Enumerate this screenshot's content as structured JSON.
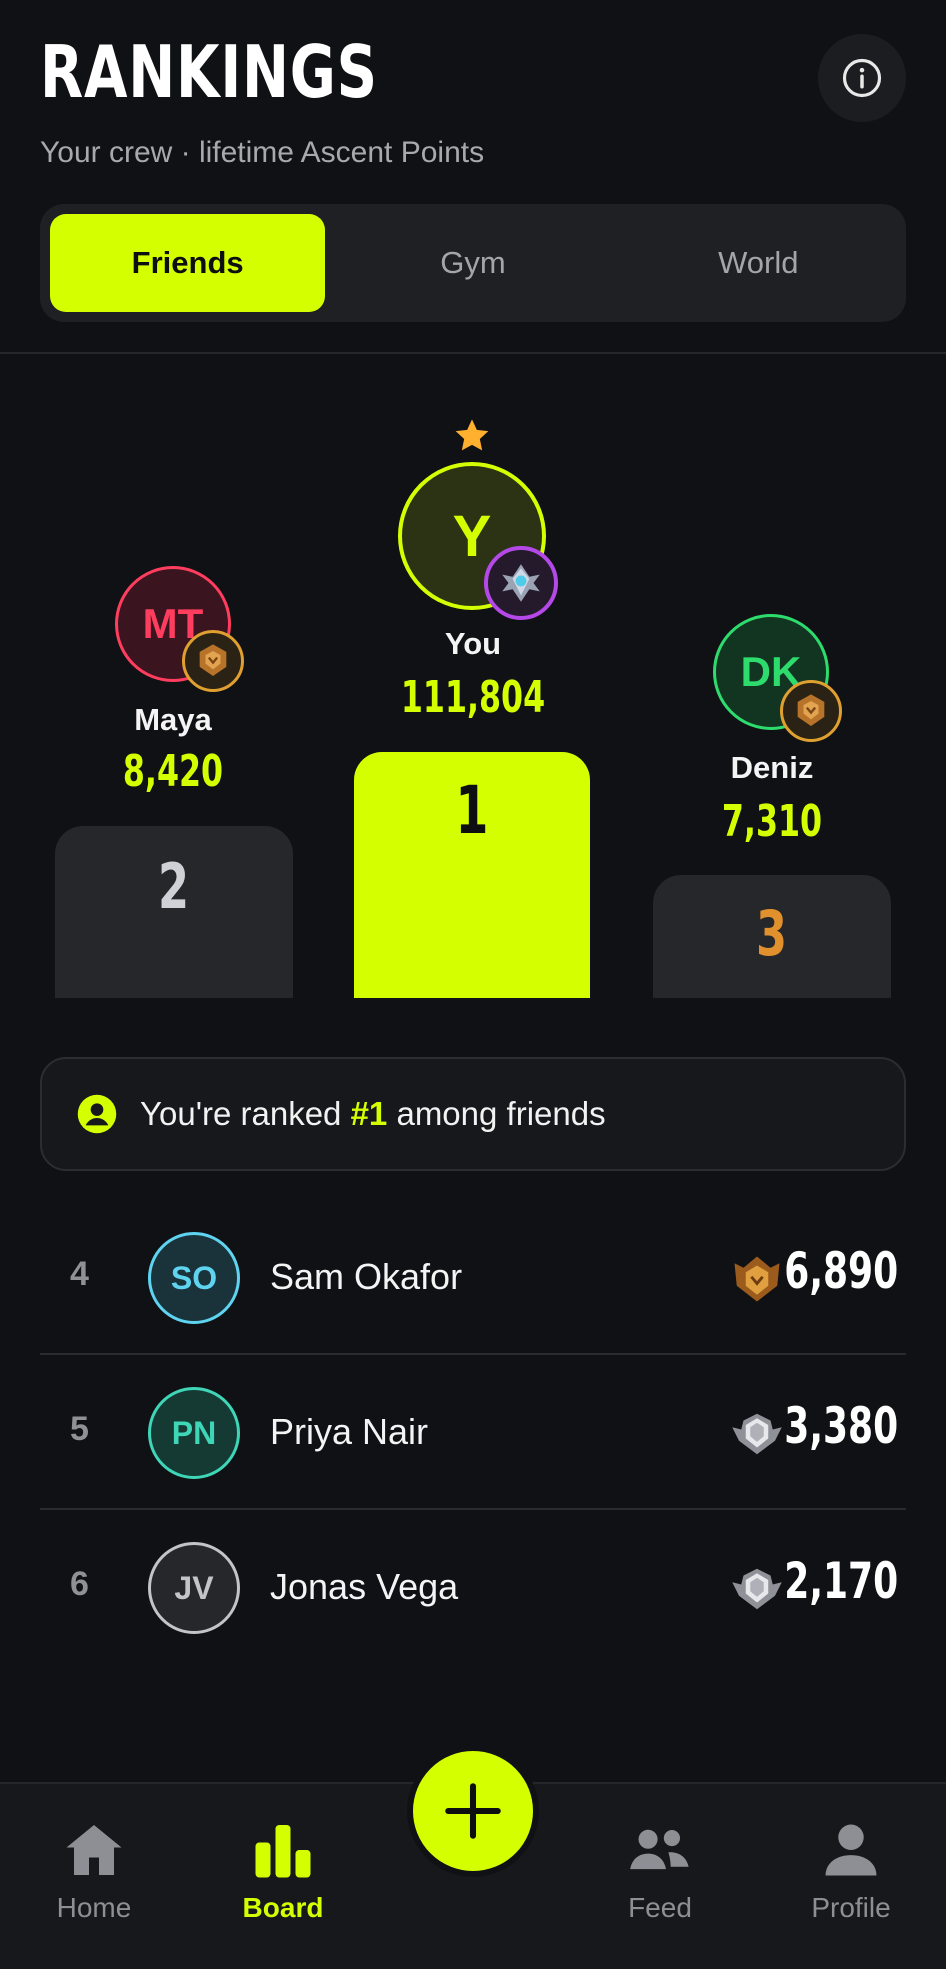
{
  "header": {
    "title": "RANKINGS",
    "subtitle": "Your crew · lifetime Ascent Points",
    "info_icon": "info-icon"
  },
  "tabs": [
    {
      "label": "Friends",
      "active": true
    },
    {
      "label": "Gym",
      "active": false
    },
    {
      "label": "World",
      "active": false
    }
  ],
  "podium": {
    "first": {
      "initials": "Y",
      "name": "You",
      "score": "111,804",
      "place": "1",
      "color": "#d4ff00",
      "tier": "diamond",
      "highlight": "star-icon"
    },
    "second": {
      "initials": "MT",
      "name": "Maya",
      "score": "8,420",
      "place": "2",
      "color": "#ff3d5e",
      "tier": "bronze"
    },
    "third": {
      "initials": "DK",
      "name": "Deniz",
      "score": "7,310",
      "place": "3",
      "color": "#2edc6e",
      "tier": "bronze"
    }
  },
  "banner": {
    "prefix": "You're ranked ",
    "rank": "#1",
    "suffix": " among friends"
  },
  "list": [
    {
      "rank": "4",
      "initials": "SO",
      "name": "Sam Okafor",
      "score": "6,890",
      "tier": "bronze",
      "color": "#5fd4f0"
    },
    {
      "rank": "5",
      "initials": "PN",
      "name": "Priya Nair",
      "score": "3,380",
      "tier": "silver",
      "color": "#3fd6b8"
    },
    {
      "rank": "6",
      "initials": "JV",
      "name": "Jonas Vega",
      "score": "2,170",
      "tier": "silver",
      "color": "#c2c4c8"
    }
  ],
  "nav": {
    "home": "Home",
    "board": "Board",
    "feed": "Feed",
    "profile": "Profile",
    "fab_icon": "plus-icon"
  },
  "colors": {
    "accent": "#d4ff00",
    "background": "#101114",
    "bronze": "#e0a030",
    "silver": "#c9ccd1",
    "third_place": "#e0902c"
  }
}
